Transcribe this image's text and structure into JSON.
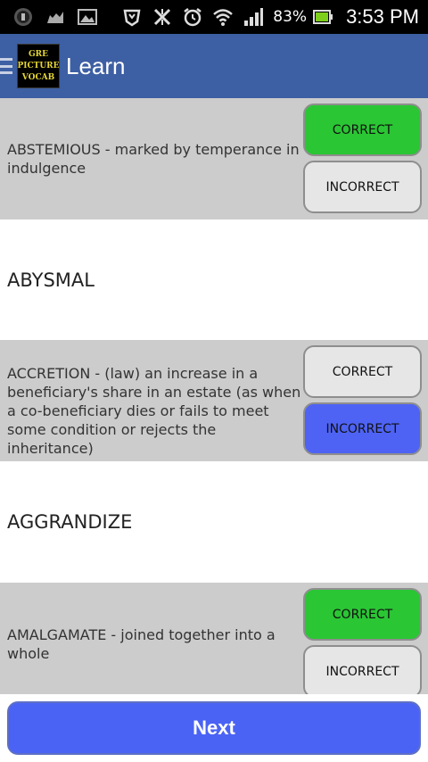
{
  "status_bar": {
    "battery_percent": "83%",
    "time": "3:53 PM",
    "icons": [
      "usb-debug-icon",
      "cat-icon",
      "image-icon",
      "vpn-icon",
      "network-off-icon",
      "alarm-icon",
      "wifi-icon",
      "signal-icon",
      "battery-icon"
    ]
  },
  "action_bar": {
    "title": "Learn",
    "logo_lines": [
      "GRE",
      "PICTURE",
      "VOCAB"
    ]
  },
  "words": [
    {
      "text": "ABSTEMIOUS - marked by temperance in indulgence",
      "state": "correct",
      "correct_label": "CORRECT",
      "incorrect_label": "INCORRECT"
    },
    {
      "text": "ABYSMAL"
    },
    {
      "text": "ACCRETION - (law) an increase in a beneficiary's share in an estate (as when a co-beneficiary dies or fails to meet some condition or rejects the inheritance)",
      "state": "incorrect",
      "correct_label": "CORRECT",
      "incorrect_label": "INCORRECT"
    },
    {
      "text": "AGGRANDIZE"
    },
    {
      "text": "AMALGAMATE - joined together into a whole",
      "state": "correct",
      "correct_label": "CORRECT",
      "incorrect_label": "INCORRECT"
    }
  ],
  "footer": {
    "next_label": "Next"
  },
  "colors": {
    "action_bar": "#3d5fa3",
    "answered_row": "#cccccc",
    "correct_selected": "#2ac634",
    "incorrect_selected": "#4e63f4",
    "next_button": "#4a63f5"
  }
}
